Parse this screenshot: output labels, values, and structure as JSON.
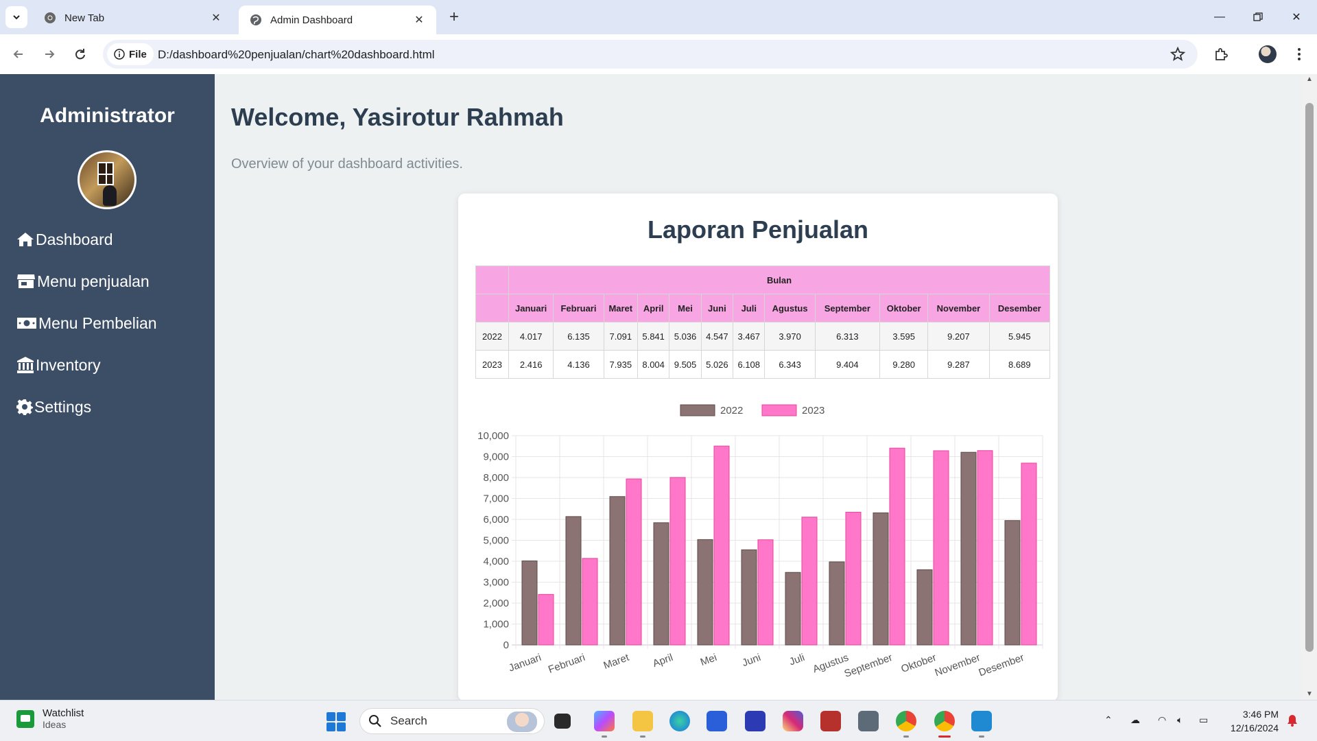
{
  "browser": {
    "tabs": [
      {
        "title": "New Tab",
        "active": false
      },
      {
        "title": "Admin Dashboard",
        "active": true
      }
    ],
    "site_chip": "File",
    "url": "D:/dashboard%20penjualan/chart%20dashboard.html"
  },
  "sidebar": {
    "title": "Administrator",
    "items": [
      {
        "label": "Dashboard",
        "icon": "home-icon"
      },
      {
        "label": "Menu penjualan",
        "icon": "store-icon"
      },
      {
        "label": "Menu Pembelian",
        "icon": "money-icon"
      },
      {
        "label": "Inventory",
        "icon": "bank-icon"
      },
      {
        "label": "Settings",
        "icon": "gear-icon"
      }
    ]
  },
  "main": {
    "welcome": "Welcome, Yasirotur Rahmah",
    "overview": "Overview of your dashboard activities."
  },
  "report": {
    "title": "Laporan Penjualan",
    "group_header": "Bulan",
    "months": [
      "Januari",
      "Februari",
      "Maret",
      "April",
      "Mei",
      "Juni",
      "Juli",
      "Agustus",
      "September",
      "Oktober",
      "November",
      "Desember"
    ],
    "rows": [
      {
        "year": "2022",
        "values": [
          "4.017",
          "6.135",
          "7.091",
          "5.841",
          "5.036",
          "4.547",
          "3.467",
          "3.970",
          "6.313",
          "3.595",
          "9.207",
          "5.945"
        ]
      },
      {
        "year": "2023",
        "values": [
          "2.416",
          "4.136",
          "7.935",
          "8.004",
          "9.505",
          "5.026",
          "6.108",
          "6.343",
          "9.404",
          "9.280",
          "9.287",
          "8.689"
        ]
      }
    ]
  },
  "chart_data": {
    "type": "bar",
    "categories": [
      "Januari",
      "Februari",
      "Maret",
      "April",
      "Mei",
      "Juni",
      "Juli",
      "Agustus",
      "September",
      "Oktober",
      "November",
      "Desember"
    ],
    "series": [
      {
        "name": "2022",
        "color": "#8c7373",
        "border": "#5e4a4a",
        "values": [
          4017,
          6135,
          7091,
          5841,
          5036,
          4547,
          3467,
          3970,
          6313,
          3595,
          9207,
          5945
        ]
      },
      {
        "name": "2023",
        "color": "#ff77c8",
        "border": "#e6449f",
        "values": [
          2416,
          4136,
          7935,
          8004,
          9505,
          5026,
          6108,
          6343,
          9404,
          9280,
          9287,
          8689
        ]
      }
    ],
    "ylim": [
      0,
      10000
    ],
    "yticks": [
      0,
      1000,
      2000,
      3000,
      4000,
      5000,
      6000,
      7000,
      8000,
      9000,
      10000
    ],
    "ytick_labels": [
      "0",
      "1,000",
      "2,000",
      "3,000",
      "4,000",
      "5,000",
      "6,000",
      "7,000",
      "8,000",
      "9,000",
      "10,000"
    ],
    "grid": true,
    "legend": "top-center"
  },
  "taskbar": {
    "widget_title": "Watchlist",
    "widget_sub": "Ideas",
    "search_label": "Search",
    "time": "3:46 PM",
    "date": "12/16/2024"
  }
}
